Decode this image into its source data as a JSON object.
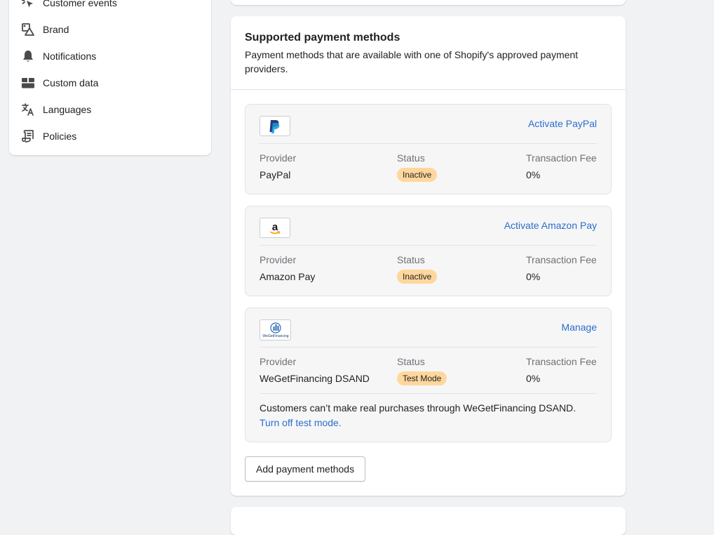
{
  "sidebar": {
    "items": [
      {
        "label": "Customer events",
        "icon": "cursor-click-icon"
      },
      {
        "label": "Brand",
        "icon": "brand-icon"
      },
      {
        "label": "Notifications",
        "icon": "bell-icon"
      },
      {
        "label": "Custom data",
        "icon": "custom-data-icon"
      },
      {
        "label": "Languages",
        "icon": "translate-icon"
      },
      {
        "label": "Policies",
        "icon": "policy-document-icon"
      }
    ]
  },
  "payments": {
    "title": "Supported payment methods",
    "subtitle": "Payment methods that are available with one of Shopify's approved payment providers.",
    "col_provider": "Provider",
    "col_status": "Status",
    "col_fee": "Transaction Fee",
    "providers": [
      {
        "name": "PayPal",
        "action": "Activate PayPal",
        "status": "Inactive",
        "fee": "0%",
        "logo": "paypal-logo"
      },
      {
        "name": "Amazon Pay",
        "action": "Activate Amazon Pay",
        "status": "Inactive",
        "fee": "0%",
        "logo": "amazon-logo"
      },
      {
        "name": "WeGetFinancing DSAND",
        "action": "Manage",
        "status": "Test Mode",
        "fee": "0%",
        "logo": "wegetfinancing-logo",
        "note": "Customers can’t make real purchases through WeGetFinancing DSAND.",
        "note_link": "Turn off test mode.",
        "logo_text": "WeGetFinancing"
      }
    ],
    "add_button": "Add payment methods"
  },
  "colors": {
    "link": "#2c6ecb",
    "badge": "#ffd79d",
    "background": "#f1f2f4"
  }
}
